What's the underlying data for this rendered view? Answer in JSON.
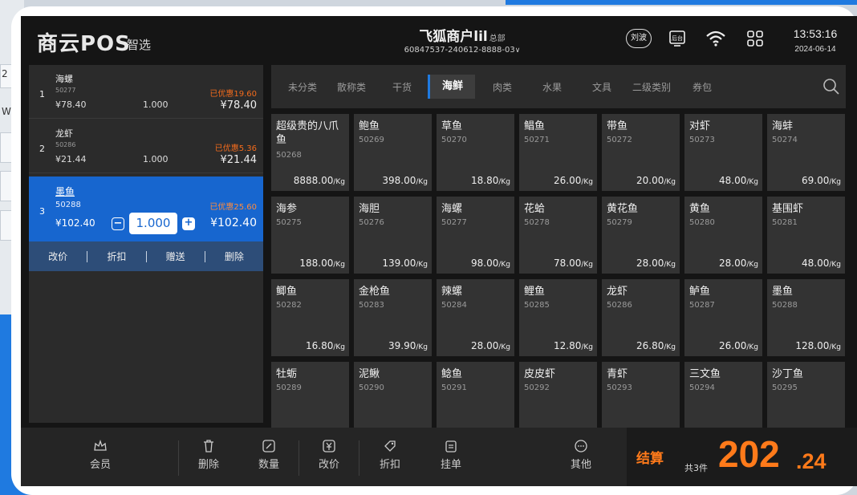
{
  "background": {
    "left_glyphs": [
      "2",
      "W"
    ]
  },
  "header": {
    "logo": "商云POS",
    "logo_sub": "智选",
    "merchant_name": "飞狐商户lil",
    "merchant_tag": "总部",
    "merchant_id": "60847537-240612-8888-03",
    "user_badge": "刘波",
    "backend_label": "后台",
    "time": "13:53:16",
    "date": "2024-06-14"
  },
  "cart": {
    "items": [
      {
        "index": "1",
        "name": "海螺",
        "code": "50277",
        "discount": "已优惠19.60",
        "unit_price": "¥78.40",
        "quantity": "1.000",
        "total": "¥78.40"
      },
      {
        "index": "2",
        "name": "龙虾",
        "code": "50286",
        "discount": "已优惠5.36",
        "unit_price": "¥21.44",
        "quantity": "1.000",
        "total": "¥21.44"
      },
      {
        "index": "3",
        "name": "墨鱼",
        "code": "50288",
        "discount": "已优惠25.60",
        "unit_price": "¥102.40",
        "quantity": "1.000",
        "total": "¥102.40"
      }
    ],
    "actions": [
      "改价",
      "折扣",
      "赠送",
      "删除"
    ]
  },
  "category_tabs": [
    "未分类",
    "散称类",
    "干货",
    "海鲜",
    "肉类",
    "水果",
    "文具",
    "二级类别",
    "券包"
  ],
  "active_tab": "海鲜",
  "products": [
    {
      "name": "超级贵的八爪鱼",
      "code": "50268",
      "price": "8888.00",
      "unit": "/Kg"
    },
    {
      "name": "鲍鱼",
      "code": "50269",
      "price": "398.00",
      "unit": "/Kg"
    },
    {
      "name": "草鱼",
      "code": "50270",
      "price": "18.80",
      "unit": "/Kg"
    },
    {
      "name": "鲳鱼",
      "code": "50271",
      "price": "26.00",
      "unit": "/Kg"
    },
    {
      "name": "带鱼",
      "code": "50272",
      "price": "20.00",
      "unit": "/Kg"
    },
    {
      "name": "对虾",
      "code": "50273",
      "price": "48.00",
      "unit": "/Kg"
    },
    {
      "name": "海蚌",
      "code": "50274",
      "price": "69.00",
      "unit": "/Kg"
    },
    {
      "name": "海参",
      "code": "50275",
      "price": "188.00",
      "unit": "/Kg"
    },
    {
      "name": "海胆",
      "code": "50276",
      "price": "139.00",
      "unit": "/Kg"
    },
    {
      "name": "海螺",
      "code": "50277",
      "price": "98.00",
      "unit": "/Kg"
    },
    {
      "name": "花蛤",
      "code": "50278",
      "price": "78.00",
      "unit": "/Kg"
    },
    {
      "name": "黄花鱼",
      "code": "50279",
      "price": "28.00",
      "unit": "/Kg"
    },
    {
      "name": "黄鱼",
      "code": "50280",
      "price": "28.00",
      "unit": "/Kg"
    },
    {
      "name": "基围虾",
      "code": "50281",
      "price": "48.00",
      "unit": "/Kg"
    },
    {
      "name": "鲫鱼",
      "code": "50282",
      "price": "16.80",
      "unit": "/Kg"
    },
    {
      "name": "金枪鱼",
      "code": "50283",
      "price": "39.90",
      "unit": "/Kg"
    },
    {
      "name": "辣螺",
      "code": "50284",
      "price": "28.00",
      "unit": "/Kg"
    },
    {
      "name": "鲤鱼",
      "code": "50285",
      "price": "12.80",
      "unit": "/Kg"
    },
    {
      "name": "龙虾",
      "code": "50286",
      "price": "26.80",
      "unit": "/Kg"
    },
    {
      "name": "鲈鱼",
      "code": "50287",
      "price": "26.00",
      "unit": "/Kg"
    },
    {
      "name": "墨鱼",
      "code": "50288",
      "price": "128.00",
      "unit": "/Kg"
    },
    {
      "name": "牡蛎",
      "code": "50289",
      "price": "",
      "unit": ""
    },
    {
      "name": "泥鳅",
      "code": "50290",
      "price": "",
      "unit": ""
    },
    {
      "name": "鲶鱼",
      "code": "50291",
      "price": "",
      "unit": ""
    },
    {
      "name": "皮皮虾",
      "code": "50292",
      "price": "",
      "unit": ""
    },
    {
      "name": "青虾",
      "code": "50293",
      "price": "",
      "unit": ""
    },
    {
      "name": "三文鱼",
      "code": "50294",
      "price": "",
      "unit": ""
    },
    {
      "name": "沙丁鱼",
      "code": "50295",
      "price": "",
      "unit": ""
    }
  ],
  "bottom_bar": {
    "buttons": [
      "会员",
      "删除",
      "数量",
      "改价",
      "折扣",
      "挂单",
      "其他"
    ],
    "checkout_label": "结算",
    "count_label": "共3件",
    "amount_int": "202",
    "amount_dec": ".24"
  },
  "colors": {
    "accent": "#1766cf",
    "discount": "#f36b1c",
    "checkout": "#ff7a1a",
    "background": "#151515"
  }
}
